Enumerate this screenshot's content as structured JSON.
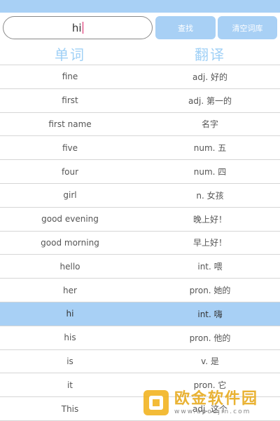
{
  "search": {
    "value": "hi"
  },
  "buttons": {
    "search_label": "查找",
    "clear_label": "清空词库"
  },
  "header": {
    "word": "单词",
    "translation": "翻译"
  },
  "rows": [
    {
      "word": "fine",
      "translation": "adj. 好的"
    },
    {
      "word": "first",
      "translation": "adj. 第一的"
    },
    {
      "word": "first name",
      "translation": "名字"
    },
    {
      "word": "five",
      "translation": "num. 五"
    },
    {
      "word": "four",
      "translation": "num. 四"
    },
    {
      "word": "girl",
      "translation": "n. 女孩"
    },
    {
      "word": "good evening",
      "translation": "晚上好！"
    },
    {
      "word": "good morning",
      "translation": "早上好！"
    },
    {
      "word": "hello",
      "translation": "int. 喂"
    },
    {
      "word": "her",
      "translation": "pron. 她的"
    },
    {
      "word": "hi",
      "translation": "int. 嗨",
      "selected": true
    },
    {
      "word": "his",
      "translation": "pron. 他的"
    },
    {
      "word": "is",
      "translation": "v. 是"
    },
    {
      "word": "it",
      "translation": "pron. 它"
    },
    {
      "word": "This",
      "translation": "adj. 这个"
    }
  ],
  "watermark": {
    "name": "欧金软件园",
    "url": "www.apoujin.com"
  },
  "colors": {
    "accent": "#a8d0f5",
    "header_text": "#9fd0f6",
    "caret": "#d81b60",
    "watermark": "#e6a817"
  }
}
